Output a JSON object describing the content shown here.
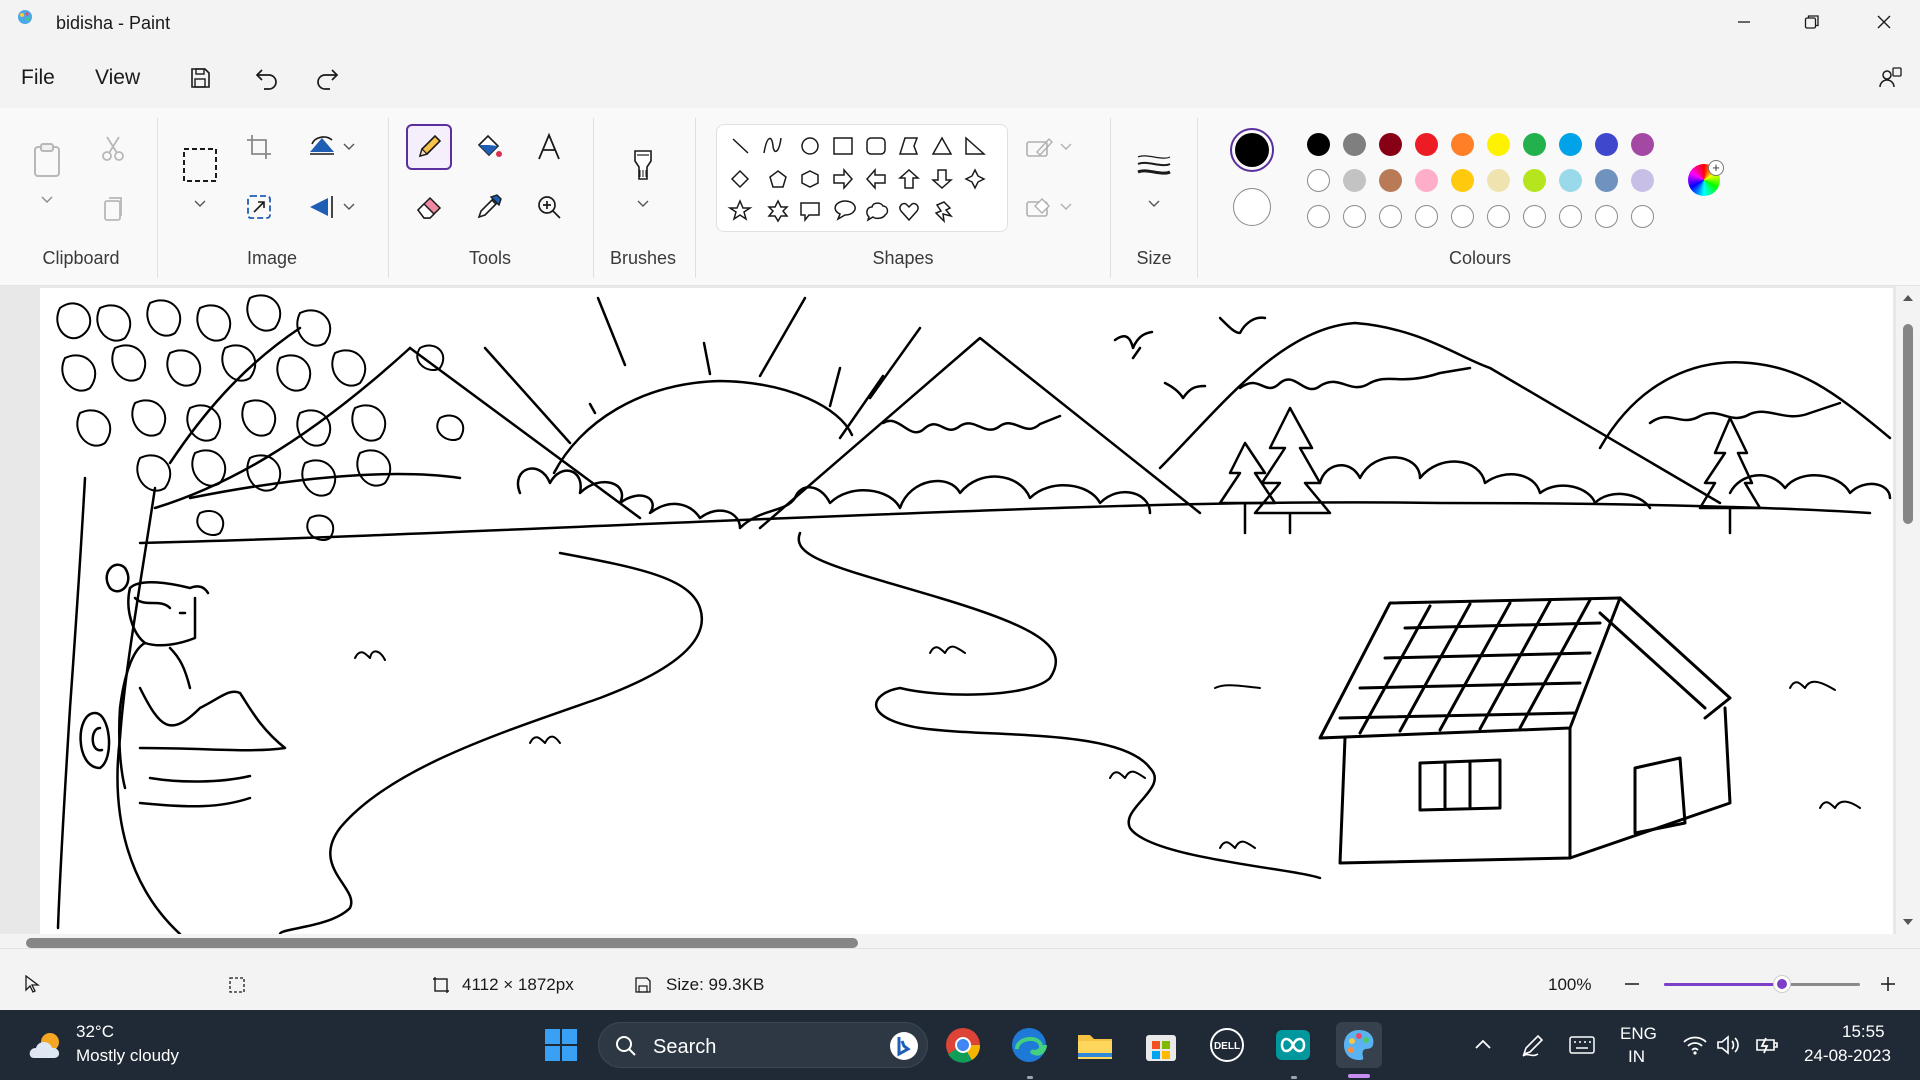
{
  "window": {
    "title": "bidisha - Paint"
  },
  "menu": {
    "file": "File",
    "view": "View"
  },
  "ribbon": {
    "groups": {
      "clipboard": "Clipboard",
      "image": "Image",
      "tools": "Tools",
      "brushes": "Brushes",
      "shapes": "Shapes",
      "size": "Size",
      "colours": "Colours"
    },
    "active_tool": "pencil",
    "primary_color": "#000000",
    "secondary_color": "#ffffff",
    "palette_row1": [
      "#000000",
      "#7f7f7f",
      "#880015",
      "#ed1c24",
      "#ff7f27",
      "#fff200",
      "#22b14c",
      "#00a2e8",
      "#3f48cc",
      "#a349a4"
    ],
    "palette_row2": [
      "#ffffff",
      "#c3c3c3",
      "#b97a57",
      "#ffaec9",
      "#ffc90e",
      "#efe4b0",
      "#b5e61d",
      "#99d9ea",
      "#7092be",
      "#c8bfe7"
    ]
  },
  "status": {
    "dimensions": "4112 × 1872px",
    "size": "Size: 99.3KB",
    "zoom": "100%",
    "zoom_level": 0.6
  },
  "taskbar": {
    "temperature": "32°C",
    "weather": "Mostly cloudy",
    "search": "Search",
    "lang_top": "ENG",
    "lang_bottom": "IN",
    "time": "15:55",
    "date": "24-08-2023"
  }
}
